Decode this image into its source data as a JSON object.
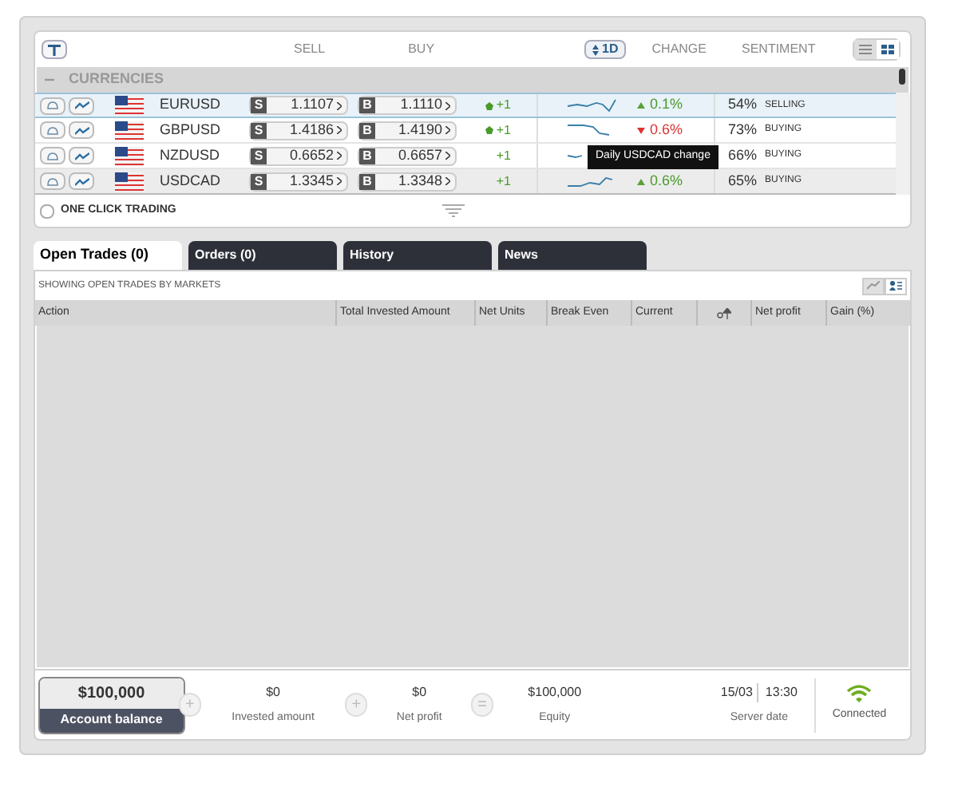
{
  "toolbar": {
    "period": "1D",
    "columns": [
      "SELL",
      "BUY",
      "CHANGE",
      "SENTIMENT"
    ],
    "views": [
      {
        "kind": "list",
        "selected": false
      },
      {
        "kind": "grid",
        "selected": true
      }
    ]
  },
  "group": {
    "title": "CURRENCIES",
    "expanded": true
  },
  "markets": [
    {
      "name": "EURUSD",
      "sell_label": "S",
      "sell": "1.1107",
      "buy_label": "B",
      "buy": "1.1110",
      "delta": "+1",
      "dot": true,
      "change": "0.1%",
      "rising": true,
      "sentiment": "54%",
      "stance": "SELLING",
      "selected": true,
      "hovered": false
    },
    {
      "name": "GBPUSD",
      "sell_label": "S",
      "sell": "1.4186",
      "buy_label": "B",
      "buy": "1.4190",
      "delta": "+1",
      "dot": true,
      "change": "0.6%",
      "rising": false,
      "sentiment": "73%",
      "stance": "BUYING",
      "selected": false,
      "hovered": false
    },
    {
      "name": "NZDUSD",
      "sell_label": "S",
      "sell": "0.6652",
      "buy_label": "B",
      "buy": "0.6657",
      "delta": "+1",
      "dot": false,
      "sentiment": "66%",
      "stance": "BUYING",
      "selected": false,
      "hovered": false
    },
    {
      "name": "USDCAD",
      "sell_label": "S",
      "sell": "1.3345",
      "buy_label": "B",
      "buy": "1.3348",
      "delta": "+1",
      "dot": false,
      "change": "0.6%",
      "rising": true,
      "sentiment": "65%",
      "stance": "BUYING",
      "selected": false,
      "hovered": true
    }
  ],
  "tooltip": "Daily USDCAD change",
  "one_click_trading": {
    "label": "ONE CLICK TRADING",
    "checked": false
  },
  "tabs": [
    {
      "label": "Open Trades (0)",
      "selected": true
    },
    {
      "label": "Orders (0)",
      "selected": false
    },
    {
      "label": "History",
      "selected": false
    },
    {
      "label": "News",
      "selected": false
    }
  ],
  "trades": {
    "caption": "SHOWING OPEN TRADES BY MARKETS",
    "views": [
      {
        "kind": "chart",
        "selected": false
      },
      {
        "kind": "people",
        "selected": true
      }
    ],
    "columns": [
      {
        "kind": "text",
        "label": "Action"
      },
      {
        "kind": "text",
        "label": "Total Invested Amount"
      },
      {
        "kind": "text",
        "label": "Net Units"
      },
      {
        "kind": "text",
        "label": "Break Even"
      },
      {
        "kind": "text",
        "label": "Current"
      },
      {
        "kind": "icon"
      },
      {
        "kind": "text",
        "label": "Net profit"
      },
      {
        "kind": "text",
        "label": "Gain (%)"
      }
    ]
  },
  "summary": {
    "balance": {
      "value": "$100,000",
      "label": "Account balance"
    },
    "items": [
      {
        "value": "$0",
        "label": "Invested amount"
      },
      {
        "value": "$0",
        "label": "Net profit"
      },
      {
        "value": "$100,000",
        "label": "Equity"
      }
    ],
    "operators": [
      "+",
      "+",
      "="
    ],
    "server": {
      "date": "15/03",
      "time": "13:30",
      "label": "Server date"
    },
    "connection": {
      "label": "Connected",
      "connected": true
    }
  }
}
